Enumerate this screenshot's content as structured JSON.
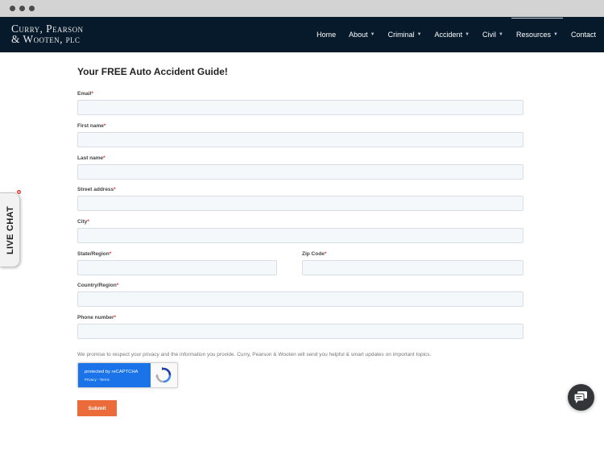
{
  "header": {
    "logo_line1": "Curry, Pearson",
    "logo_line2": "& Wooten, plc",
    "nav": [
      {
        "label": "Home"
      },
      {
        "label": "About"
      },
      {
        "label": "Criminal"
      },
      {
        "label": "Accident"
      },
      {
        "label": "Civil"
      },
      {
        "label": "Resources"
      },
      {
        "label": "Contact"
      }
    ]
  },
  "form": {
    "title": "Your FREE Auto Accident Guide!",
    "required_mark": "*",
    "fields": {
      "email": {
        "label": "Email",
        "value": ""
      },
      "first_name": {
        "label": "First name",
        "value": ""
      },
      "last_name": {
        "label": "Last name",
        "value": ""
      },
      "street": {
        "label": "Street address",
        "value": ""
      },
      "city": {
        "label": "City",
        "value": ""
      },
      "state": {
        "label": "State/Region",
        "value": ""
      },
      "zip": {
        "label": "Zip Code",
        "value": ""
      },
      "country": {
        "label": "Country/Region",
        "value": ""
      },
      "phone": {
        "label": "Phone number",
        "value": ""
      }
    },
    "privacy_text": "We promise to respect your privacy and the information you provide. Curry, Pearson & Wooten will send you helpful & smart updates on important topics.",
    "recaptcha": {
      "text": "protected by reCAPTCHA",
      "links": "Privacy - Terms"
    },
    "submit_label": "Submit"
  },
  "live_chat": {
    "label": "LIVE CHAT"
  },
  "colors": {
    "header_bg": "#071a2c",
    "submit_bg": "#ec6b3a",
    "required": "#e0312a",
    "recaptcha_blue": "#1a73e8"
  },
  "icons": {
    "chat_fab": "chat-bubbles-icon",
    "recaptcha": "recaptcha-icon"
  }
}
